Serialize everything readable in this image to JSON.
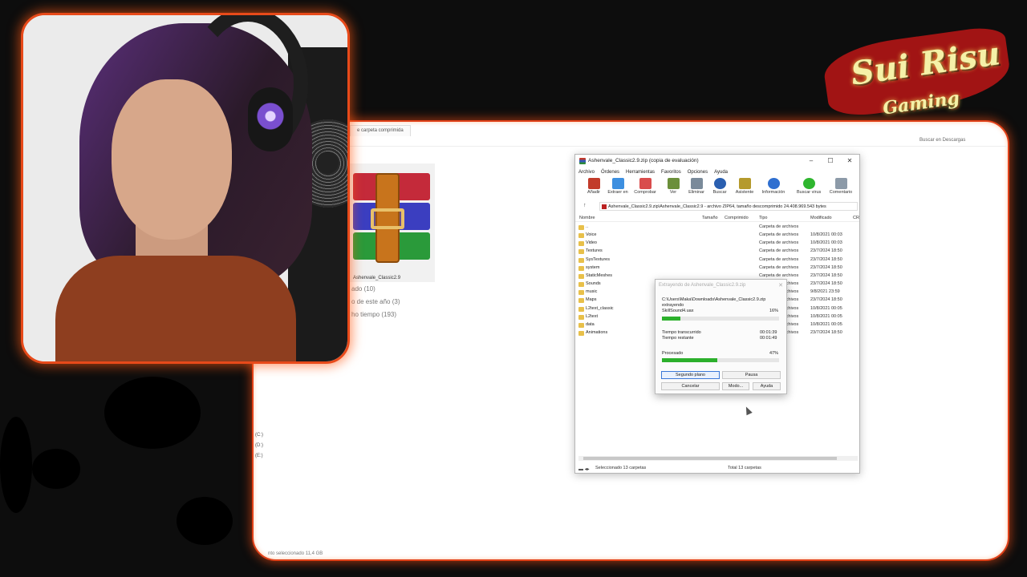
{
  "explorer": {
    "tab_label": "e carpeta comprimida",
    "search_text": "Buscar en Descargas",
    "thumb_label": "Ashenvale_Classic2.9",
    "group_1": "ado (10)",
    "group_2": "o de este año (3)",
    "group_3": "ho tiempo (193)",
    "drives": [
      "(C:)",
      "(D:)",
      "(E:)"
    ],
    "status": "nto seleccionado  11,4 GB"
  },
  "winrar": {
    "title": "Ashenvale_Classic2.9.zip (copia de evaluación)",
    "menu": [
      "Archivo",
      "Órdenes",
      "Herramientas",
      "Favoritos",
      "Opciones",
      "Ayuda"
    ],
    "toolbar": [
      {
        "label": "Añadir",
        "icon": "add-icon",
        "color": "#c23b2a"
      },
      {
        "label": "Extraer en",
        "icon": "extract-folder-icon",
        "color": "#3d8fe0"
      },
      {
        "label": "Comprobar",
        "icon": "test-icon",
        "color": "#d94c4c"
      },
      {
        "label": "Ver",
        "icon": "book-icon",
        "color": "#6b8f3a"
      },
      {
        "label": "Eliminar",
        "icon": "trash-icon",
        "color": "#7a8a9a"
      },
      {
        "label": "Buscar",
        "icon": "magnifier-icon",
        "color": "#2a5fb0"
      },
      {
        "label": "Asistente",
        "icon": "wand-icon",
        "color": "#b59a2c"
      },
      {
        "label": "Información",
        "icon": "info-icon",
        "color": "#2f6fd0"
      },
      {
        "label": "Buscar virus",
        "icon": "virus-scan-icon",
        "color": "#2fb62f"
      },
      {
        "label": "Comentario",
        "icon": "comment-icon",
        "color": "#8c9aa8"
      }
    ],
    "address": "Ashenvale_Classic2.9.zip\\Ashenvale_Classic2.9 - archivo ZIP64, tamaño descomprimido 24.408.969.543 bytes",
    "columns": {
      "name": "Nombre",
      "size": "Tamaño",
      "packed": "Comprimido",
      "type": "Tipo",
      "modified": "Modificado",
      "crc": "CR"
    },
    "rows": [
      {
        "name": "..",
        "type": "Carpeta de archivos",
        "date": ""
      },
      {
        "name": "Voice",
        "type": "Carpeta de archivos",
        "date": "10/8/2021 00:03"
      },
      {
        "name": "Video",
        "type": "Carpeta de archivos",
        "date": "10/8/2021 00:03"
      },
      {
        "name": "Textures",
        "type": "Carpeta de archivos",
        "date": "23/7/2024 18:50"
      },
      {
        "name": "SysTextures",
        "type": "Carpeta de archivos",
        "date": "23/7/2024 18:50"
      },
      {
        "name": "system",
        "type": "Carpeta de archivos",
        "date": "23/7/2024 18:50"
      },
      {
        "name": "StaticMeshes",
        "type": "Carpeta de archivos",
        "date": "23/7/2024 18:50"
      },
      {
        "name": "Sounds",
        "type": "Carpeta de archivos",
        "date": "23/7/2024 18:50"
      },
      {
        "name": "music",
        "type": "Carpeta de archivos",
        "date": "9/8/2021 23:59"
      },
      {
        "name": "Maps",
        "type": "Carpeta de archivos",
        "date": "23/7/2024 18:50"
      },
      {
        "name": "L2text_classic",
        "type": "Carpeta de archivos",
        "date": "10/8/2021 00:05"
      },
      {
        "name": "L2text",
        "type": "Carpeta de archivos",
        "date": "10/8/2021 00:05"
      },
      {
        "name": "data",
        "type": "Carpeta de archivos",
        "date": "10/8/2021 00:05"
      },
      {
        "name": "Animations",
        "type": "Carpeta de archivos",
        "date": "23/7/2024 18:50"
      }
    ],
    "status_left": "Seleccionado 13 carpetas",
    "status_right": "Total 13 carpetas"
  },
  "extract_dialog": {
    "title": "Extrayendo de Ashenvale_Classic2.9.zip",
    "path": "C:\\Users\\Maka\\Downloads\\Ashenvale_Classic2.9.zip",
    "action": "extrayendo",
    "file": "SkillSound4.uax",
    "file_percent": "16%",
    "file_progress": 0.16,
    "elapsed_label": "Tiempo transcurrido",
    "elapsed": "00:01:39",
    "remaining_label": "Tiempo restante",
    "remaining": "00:01:49",
    "processed_label": "Procesado",
    "processed_percent": "47%",
    "processed_progress": 0.47,
    "buttons": {
      "background": "Segundo plano",
      "pause": "Pausa",
      "cancel": "Cancelar",
      "mode": "Modo...",
      "help": "Ayuda"
    }
  },
  "logo": {
    "name": "Sui Risu",
    "sub": "Gaming"
  }
}
